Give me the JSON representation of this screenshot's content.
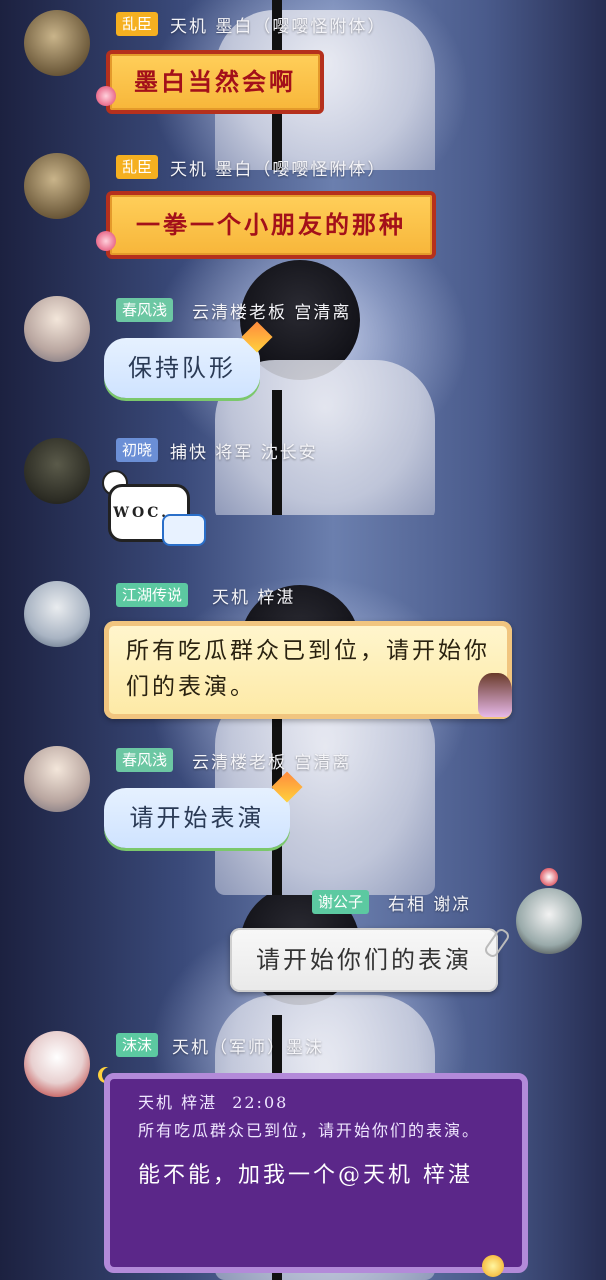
{
  "messages": [
    {
      "tag": "乱臣",
      "tag_color": "#f5b020",
      "name": "天机 墨白（嘤嘤怪附体）",
      "text": "墨白当然会啊",
      "bubble_style": "red-frame"
    },
    {
      "tag": "乱臣",
      "tag_color": "#f5b020",
      "name": "天机 墨白（嘤嘤怪附体）",
      "text": "一拳一个小朋友的那种",
      "bubble_style": "red-frame"
    },
    {
      "tag": "春风浅",
      "tag_color": "#6cc7a3",
      "name": "云清楼老板 宫清离",
      "text": "保持队形",
      "bubble_style": "kite-blue"
    },
    {
      "tag": "初晓",
      "tag_color": "#6b8fd6",
      "name": "捕快 将军 沈长安",
      "text": "WOC...",
      "bubble_style": "comic-white"
    },
    {
      "tag": "江湖传说",
      "tag_color": "#5cc9a1",
      "name": "天机 梓湛",
      "text": "所有吃瓜群众已到位，请开始你们的表演。",
      "bubble_style": "scroll"
    },
    {
      "tag": "春风浅",
      "tag_color": "#6cc7a3",
      "name": "云清楼老板 宫清离",
      "text": "请开始表演",
      "bubble_style": "kite-blue"
    },
    {
      "tag": "谢公子",
      "tag_color": "#5cc9a1",
      "name": "右相 谢凉",
      "text": "请开始你们的表演",
      "bubble_style": "paper",
      "self": true
    },
    {
      "tag": "沫沫",
      "tag_color": "#5cc9a1",
      "name": "天机（军师）墨沫",
      "bubble_style": "purple",
      "quote": {
        "author": "天机 梓湛",
        "time": "22:08",
        "text": "所有吃瓜群众已到位，请开始你们的表演。"
      },
      "text": "能不能，加我一个@天机 梓湛"
    }
  ]
}
